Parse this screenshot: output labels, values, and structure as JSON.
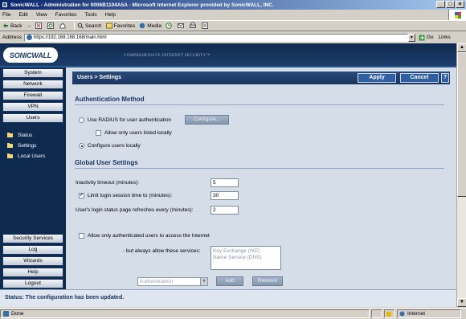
{
  "window": {
    "title": "SonicWALL - Administration for 0006B1104A5A - Microsoft Internet Explorer provided by SonicWALL, INC.",
    "min": "_",
    "max": "□",
    "close": "×"
  },
  "menu": [
    "File",
    "Edit",
    "View",
    "Favorites",
    "Tools",
    "Help"
  ],
  "toolbar": {
    "back": "Back",
    "forward": "→",
    "search": "Search",
    "favorites": "Favorites",
    "media": "Media"
  },
  "address": {
    "label": "Address",
    "url": "https://192.168.168.168/main.html",
    "go": "Go",
    "links": "Links"
  },
  "header": {
    "logo": "SONICWALL",
    "tagline": "COMPREHENSIVE INTERNET SECURITY™"
  },
  "nav": {
    "top": [
      "System",
      "Network",
      "Firewall",
      "VPN",
      "Users"
    ],
    "sub": [
      "Status",
      "Settings",
      "Local Users"
    ],
    "bottom": [
      "Security Services",
      "Log",
      "Wizards",
      "Help",
      "Logout"
    ]
  },
  "content": {
    "title": "Users > Settings",
    "apply": "Apply",
    "cancel": "Cancel",
    "help": "?",
    "auth": {
      "heading": "Authentication Method",
      "radius_label": "Use RADIUS for user authentication",
      "configure": "Configure...",
      "allow_local_label": "Allow only users listed locally",
      "local_label": "Configure users locally"
    },
    "global": {
      "heading": "Global User Settings",
      "inactivity_label": "Inactivity timeout (minutes):",
      "inactivity_value": "5",
      "limit_label": "Limit login session time to (minutes):",
      "limit_value": "30",
      "refresh_label": "User's login status page refreshes every (minutes):",
      "refresh_value": "2",
      "allow_auth_label": "Allow only authenticated users to access the Internet",
      "but_allow_label": "- but always allow these services:",
      "services": [
        "Key Exchange (IKE)",
        "Name Service (DNS)"
      ],
      "select_value": "Authentication",
      "add": "Add",
      "remove": "Remove"
    }
  },
  "status": "Status: The configuration has been updated.",
  "iestatus": {
    "done": "Done",
    "zone": "Internet"
  }
}
